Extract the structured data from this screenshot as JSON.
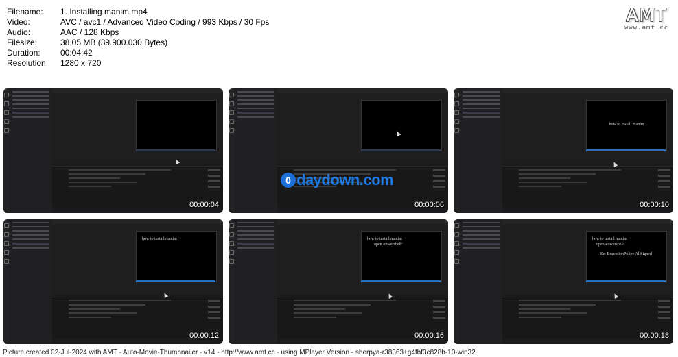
{
  "meta": [
    {
      "key": "Filename:",
      "value": "1. Installing manim.mp4"
    },
    {
      "key": "Video:",
      "value": "AVC / avc1 / Advanced Video Coding / 993 Kbps / 30 Fps"
    },
    {
      "key": "Audio:",
      "value": "AAC / 128 Kbps"
    },
    {
      "key": "Filesize:",
      "value": "38.05 MB (39.900.030 Bytes)"
    },
    {
      "key": "Duration:",
      "value": "00:04:42"
    },
    {
      "key": "Resolution:",
      "value": "1280 x 720"
    }
  ],
  "logo": {
    "main": "AMT",
    "sub": "www.amt.cc"
  },
  "thumbnails": [
    {
      "time": "00:00:04",
      "lines": []
    },
    {
      "time": "00:00:06",
      "lines": []
    },
    {
      "time": "00:00:10",
      "lines": [
        "how to install manim"
      ]
    },
    {
      "time": "00:00:12",
      "lines": [
        "how to install manim"
      ]
    },
    {
      "time": "00:00:16",
      "lines": [
        "how to install manim",
        "open Powershell:"
      ]
    },
    {
      "time": "00:00:18",
      "lines": [
        "how to install manim",
        "open Powershell:",
        "Set-ExecutionPolicy AllSigned"
      ]
    }
  ],
  "watermark": {
    "badge": "0",
    "text": "daydown.com"
  },
  "footer": "Picture created 02-Jul-2024 with AMT - Auto-Movie-Thumbnailer - v14 - http://www.amt.cc - using MPlayer Version - sherpya-r38363+g4fbf3c828b-10-win32",
  "colors": {
    "video_bg": "#1b1b1d",
    "preview_bg": "#000000",
    "accent": "#2a6dbf",
    "watermark": "#1e78e0"
  }
}
